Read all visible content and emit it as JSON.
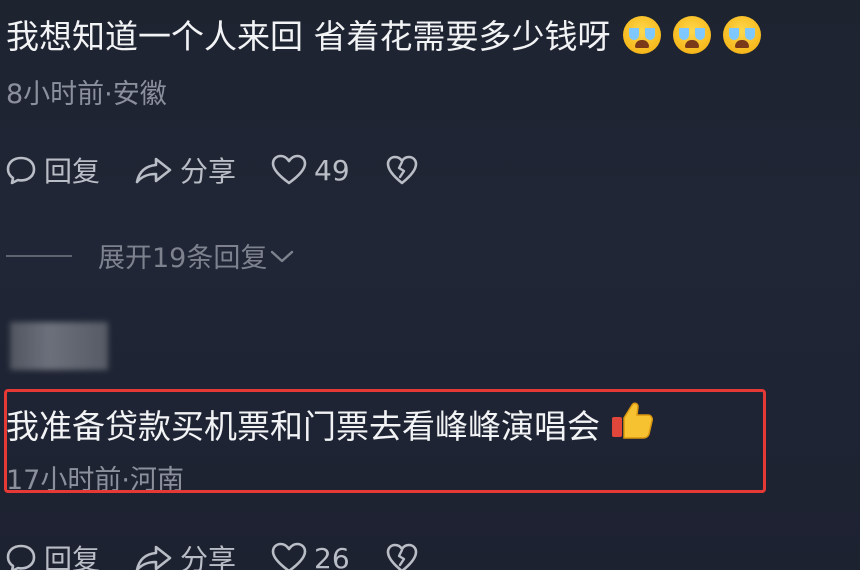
{
  "comment1": {
    "text": "我想知道一个人来回  省着花需要多少钱呀",
    "emojis": [
      "crying-face",
      "crying-face",
      "crying-face"
    ],
    "meta": "8小时前·安徽",
    "actions": {
      "reply": "回复",
      "share": "分享",
      "likes": "49"
    }
  },
  "expand": {
    "label": "展开19条回复"
  },
  "comment2": {
    "text": "我准备贷款买机票和门票去看峰峰演唱会",
    "emoji": "thumbs-up",
    "meta": "17小时前·河南",
    "actions": {
      "reply": "回复",
      "share": "分享",
      "likes": "26"
    }
  },
  "colors": {
    "background": "#1f2433",
    "highlight_border": "#e53935",
    "text_primary": "#f2f3f5",
    "text_meta": "#8b909c"
  }
}
